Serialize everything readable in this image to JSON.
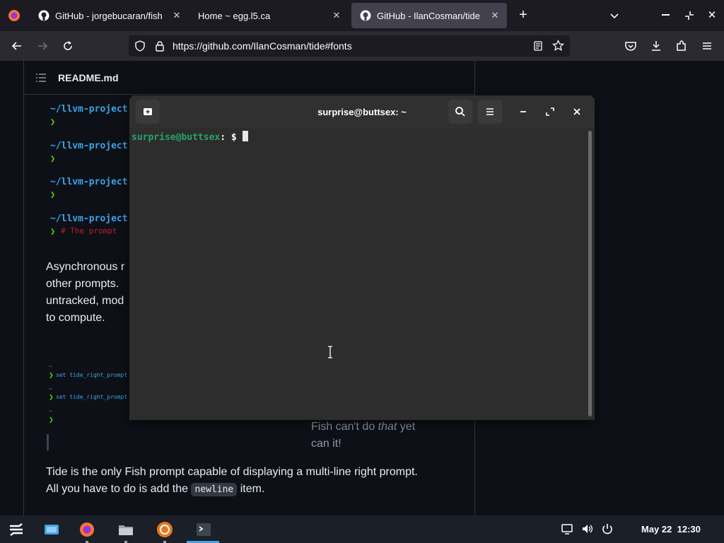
{
  "browser": {
    "tabs": [
      {
        "label": "GitHub - jorgebucaran/fish",
        "active": false
      },
      {
        "label": "Home ~ egg.l5.ca",
        "active": false
      },
      {
        "label": "GitHub - IlanCosman/tide",
        "active": true
      }
    ],
    "url": "https://github.com/IlanCosman/tide#fonts"
  },
  "readme": {
    "title": "README.md",
    "code_lines": [
      "~/llvm-project",
      "~/llvm-project",
      "~/llvm-project",
      "~/llvm-project"
    ],
    "arrow": "❯",
    "comment": "# The prompt",
    "para1": [
      "Asynchronous r",
      "other prompts.",
      "untracked, mod",
      "to compute."
    ],
    "mini_lines": [
      "set tide_right_prompt",
      "set tide_right_prompt"
    ],
    "fish_caption_1a": "Fish can't do ",
    "fish_caption_1b": "that",
    "fish_caption_1c": " yet",
    "fish_caption_2": "can it!",
    "para2_line1": "Tide is the only Fish prompt capable of displaying a multi-line right prompt.",
    "para2_line2a": "All you have to do is add the ",
    "para2_code": "newline",
    "para2_line2b": " item."
  },
  "terminal": {
    "title": "surprise@buttsex: ~",
    "prompt_user": "surprise@buttsex",
    "prompt_rest": ": $ "
  },
  "taskbar": {
    "date": "May 22",
    "time": "12:30"
  },
  "colors": {
    "accent_green": "#26a269",
    "prompt_blue": "#3ba3e8",
    "comment_red": "#c01c28"
  }
}
